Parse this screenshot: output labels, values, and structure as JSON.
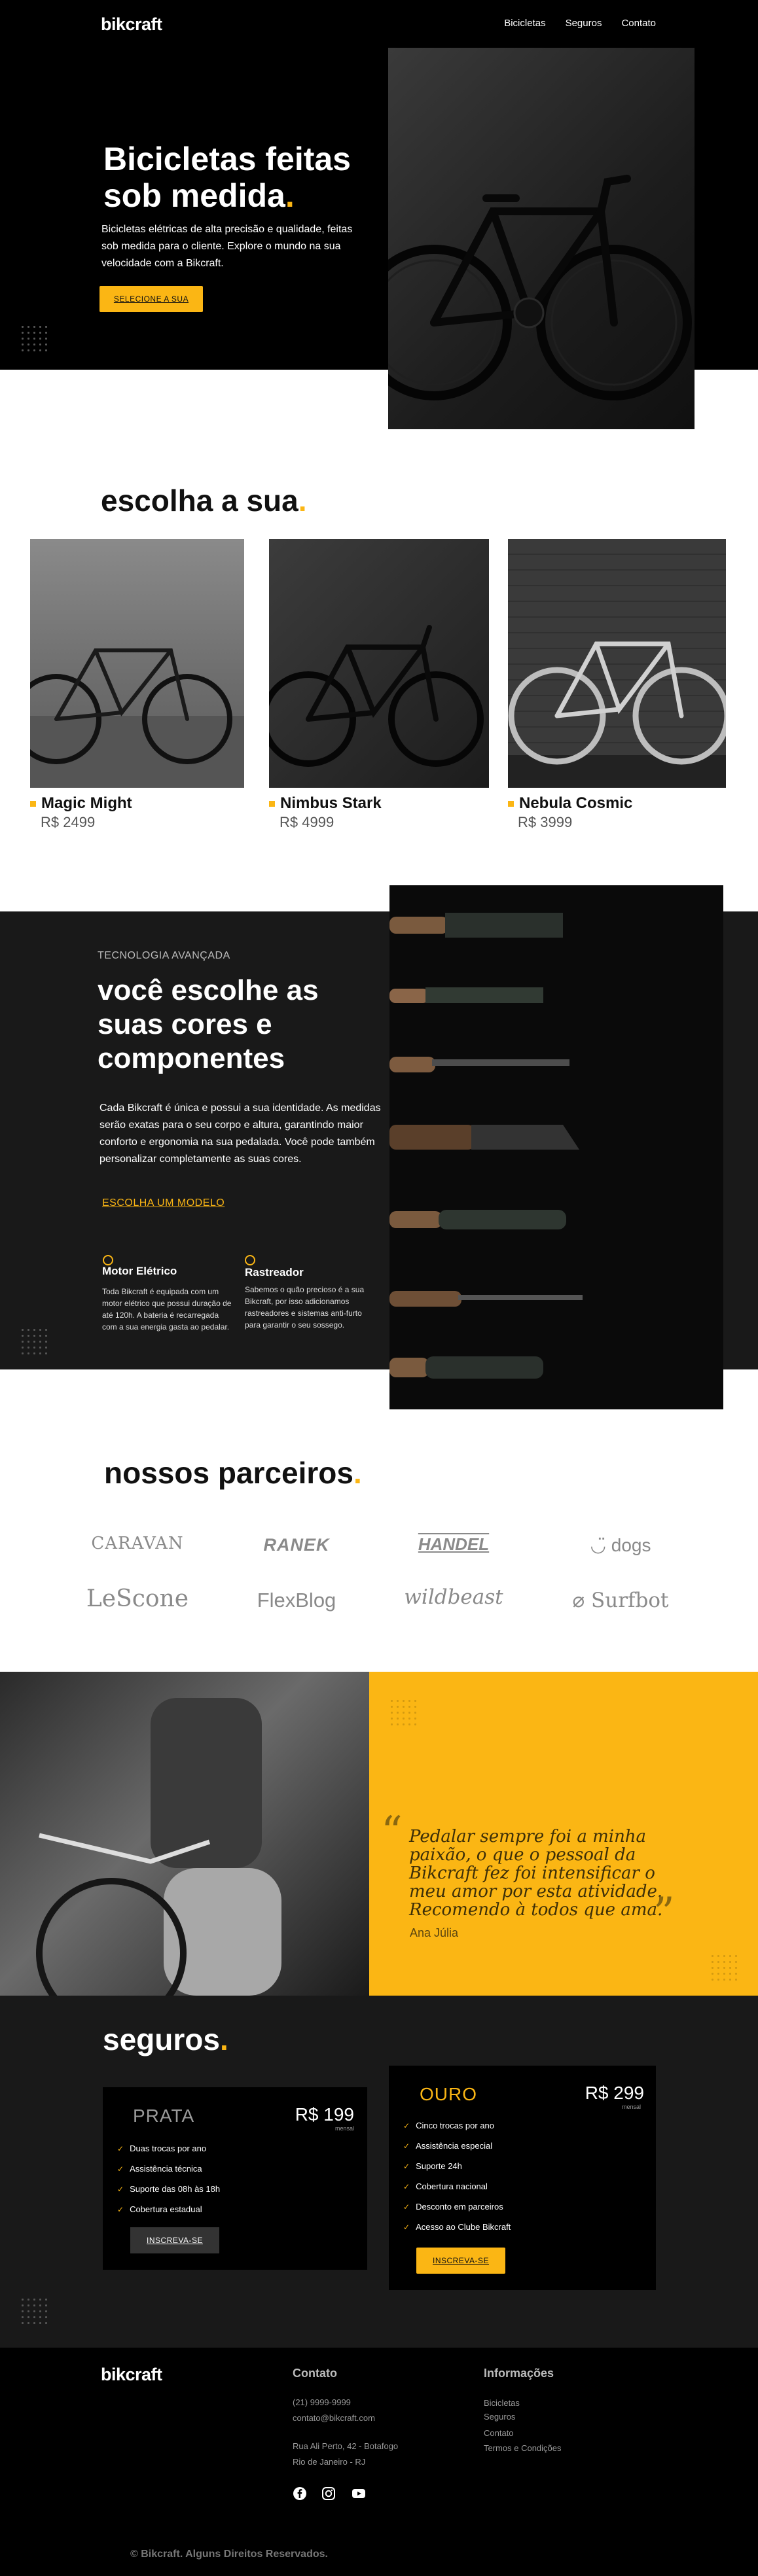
{
  "header": {
    "logo": "bikcraft",
    "nav": [
      "Bicicletas",
      "Seguros",
      "Contato"
    ]
  },
  "hero": {
    "title": "Bicicletas feitas sob medida",
    "title_dot": ".",
    "text": "Bicicletas elétricas de alta precisão e qualidade, feitas sob medida para o cliente. Explore o mundo na sua velocidade com a Bikcraft.",
    "button": "Selecione a sua"
  },
  "products": {
    "title": "escolha a sua",
    "title_dot": ".",
    "items": [
      {
        "name": "Magic Might",
        "price": "R$ 2499"
      },
      {
        "name": "Nimbus Stark",
        "price": "R$ 4999"
      },
      {
        "name": "Nebula Cosmic",
        "price": "R$ 3999"
      }
    ]
  },
  "technology": {
    "eyebrow": "Tecnologia Avançada",
    "title": "você escolhe as suas cores e componentes",
    "text": "Cada Bikcraft é única e possui a sua identidade. As medidas serão exatas para o seu corpo e altura, garantindo maior conforto e ergonomia na sua pedalada. Você pode também personalizar completamente as suas cores.",
    "link": "Escolha um modelo",
    "features": [
      {
        "title": "Motor Elétrico",
        "text": "Toda Bikcraft é equipada com um motor elétrico que possui duração de até 120h. A bateria é recarregada com a sua energia gasta ao pedalar."
      },
      {
        "title": "Rastreador",
        "text": "Sabemos o quão precioso é a sua Bikcraft, por isso adicionamos rastreadores e sistemas anti-furto para garantir o seu sossego."
      }
    ]
  },
  "partners": {
    "title": "nossos parceiros",
    "title_dot": ".",
    "logos": [
      "CARAVAN",
      "RANEK",
      "HANDEL",
      "dogs",
      "LeScone",
      "FlexBlog",
      "wildbeast",
      "Surfbot"
    ]
  },
  "testimonial": {
    "quote": "Pedalar sempre foi a minha paixão, o que o pessoal da Bikcraft fez foi intensificar o meu amor por esta atividade. Recomendo à todos que ama.",
    "author": "Ana Júlia"
  },
  "insurance": {
    "title": "seguros",
    "title_dot": ".",
    "plans": [
      {
        "name": "PRATA",
        "price": "R$ 199",
        "per": "mensal",
        "features": [
          "Duas trocas por ano",
          "Assistência técnica",
          "Suporte das 08h às 18h",
          "Cobertura estadual"
        ],
        "button": "Inscreva-se"
      },
      {
        "name": "OURO",
        "price": "R$ 299",
        "per": "mensal",
        "features": [
          "Cinco trocas por ano",
          "Assistência especial",
          "Suporte 24h",
          "Cobertura nacional",
          "Desconto em parceiros",
          "Acesso ao Clube Bikcraft"
        ],
        "button": "Inscreva-se"
      }
    ]
  },
  "footer": {
    "logo": "bikcraft",
    "contact_title": "Contato",
    "phone": "(21) 9999-9999",
    "email": "contato@bikcraft.com",
    "address1": "Rua Ali Perto, 42 - Botafogo",
    "address2": "Rio de Janeiro - RJ",
    "info_title": "Informações",
    "links": [
      "Bicicletas",
      "Seguros",
      "Contato",
      "Termos e Condições"
    ],
    "copyright": "© Bikcraft. Alguns Direitos Reservados."
  },
  "colors": {
    "accent": "#FBB614",
    "dark": "#191919",
    "black": "#000000"
  },
  "icons": [
    "motor-icon",
    "tracker-icon",
    "check-icon",
    "quote-open-icon",
    "quote-close-icon",
    "facebook-icon",
    "instagram-icon",
    "youtube-icon"
  ]
}
